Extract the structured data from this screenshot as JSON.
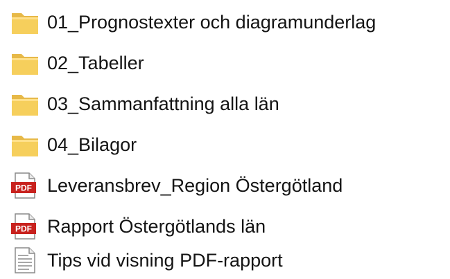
{
  "items": [
    {
      "type": "folder",
      "name": "01_Prognostexter och diagramunderlag",
      "icon": "folder-icon"
    },
    {
      "type": "folder",
      "name": "02_Tabeller",
      "icon": "folder-icon"
    },
    {
      "type": "folder",
      "name": "03_Sammanfattning alla län",
      "icon": "folder-icon"
    },
    {
      "type": "folder",
      "name": "04_Bilagor",
      "icon": "folder-icon"
    },
    {
      "type": "pdf",
      "name": "Leveransbrev_Region Östergötland",
      "icon": "pdf-icon",
      "badge": "PDF"
    },
    {
      "type": "pdf",
      "name": "Rapport Östergötlands län",
      "icon": "pdf-icon",
      "badge": "PDF"
    },
    {
      "type": "text",
      "name": "Tips vid visning PDF-rapport",
      "icon": "text-document-icon"
    }
  ],
  "colors": {
    "folder_body": "#f6cf5c",
    "folder_front": "#ffe08a",
    "pdf_red": "#c8221e",
    "text": "#141414"
  }
}
